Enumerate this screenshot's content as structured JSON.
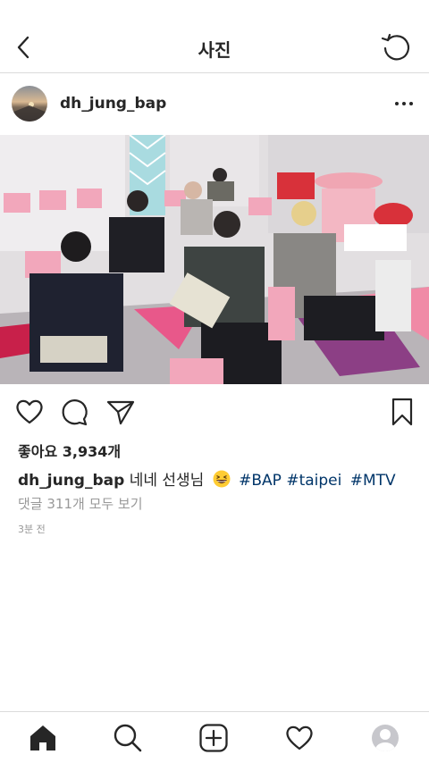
{
  "header": {
    "title": "사진",
    "back_icon": "chevron-left-icon",
    "refresh_icon": "refresh-icon"
  },
  "post": {
    "username": "dh_jung_bap",
    "more_icon": "more-horizontal-icon",
    "likes_text": "좋아요 3,934개",
    "caption": {
      "user": "dh_jung_bap",
      "text": "네네 선생님",
      "emoji": "grinning-squinting-face",
      "hashtags": [
        "#BAP",
        "#taipei",
        "#MTV"
      ]
    },
    "comments_link": "댓글 311개 모두 보기",
    "time_ago": "3분 전"
  },
  "actions": {
    "like_icon": "heart-icon",
    "comment_icon": "comment-icon",
    "share_icon": "send-icon",
    "save_icon": "bookmark-icon"
  },
  "tabbar": {
    "items": [
      "home-icon",
      "search-icon",
      "add-icon",
      "activity-heart-icon",
      "profile-icon"
    ]
  },
  "colors": {
    "text": "#262626",
    "muted": "#999999",
    "hashtag": "#003569",
    "divider": "#dbdbdb"
  }
}
